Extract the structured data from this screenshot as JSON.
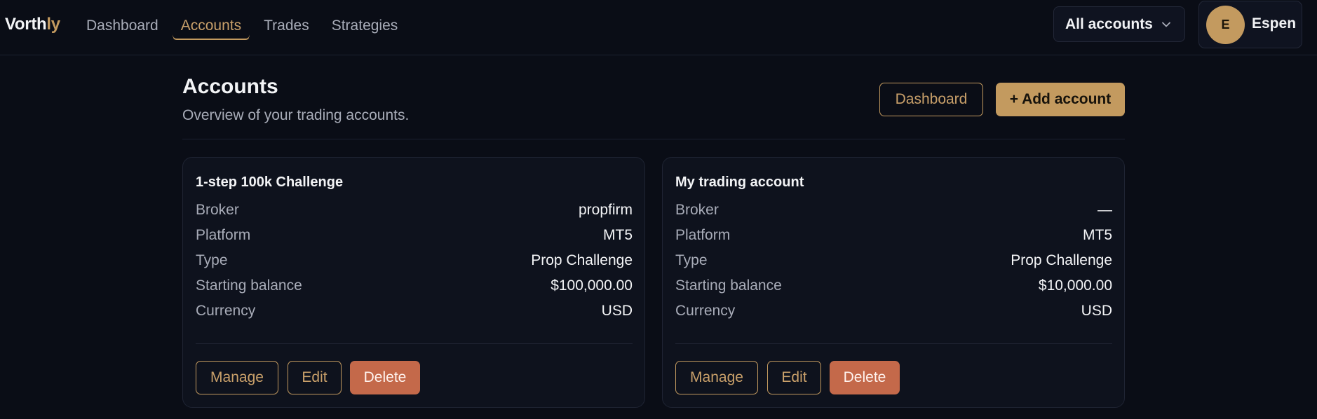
{
  "brand": {
    "part1": "Vorth",
    "part2": "ly"
  },
  "nav": {
    "items": [
      {
        "label": "Dashboard",
        "active": false
      },
      {
        "label": "Accounts",
        "active": true
      },
      {
        "label": "Trades",
        "active": false
      },
      {
        "label": "Strategies",
        "active": false
      }
    ]
  },
  "account_selector": {
    "selected": "All accounts",
    "icon": "chevron-down-icon"
  },
  "user": {
    "initial": "E",
    "name": "Espen"
  },
  "page": {
    "title": "Accounts",
    "subtitle": "Overview of your trading accounts.",
    "dashboard_button": "Dashboard",
    "add_button": "+ Add account"
  },
  "field_labels": {
    "broker": "Broker",
    "platform": "Platform",
    "type": "Type",
    "starting_balance": "Starting balance",
    "currency": "Currency"
  },
  "card_actions": {
    "manage": "Manage",
    "edit": "Edit",
    "delete": "Delete"
  },
  "accounts": [
    {
      "name": "1-step 100k Challenge",
      "broker": "propfirm",
      "platform": "MT5",
      "type": "Prop Challenge",
      "starting_balance": "$100,000.00",
      "currency": "USD"
    },
    {
      "name": "My trading account",
      "broker": "—",
      "platform": "MT5",
      "type": "Prop Challenge",
      "starting_balance": "$10,000.00",
      "currency": "USD"
    }
  ],
  "colors": {
    "background": "#0a0d16",
    "card": "#0e121d",
    "accent_gold": "#c39a5f",
    "danger": "#c4694a",
    "muted_text": "#a8acb8"
  }
}
